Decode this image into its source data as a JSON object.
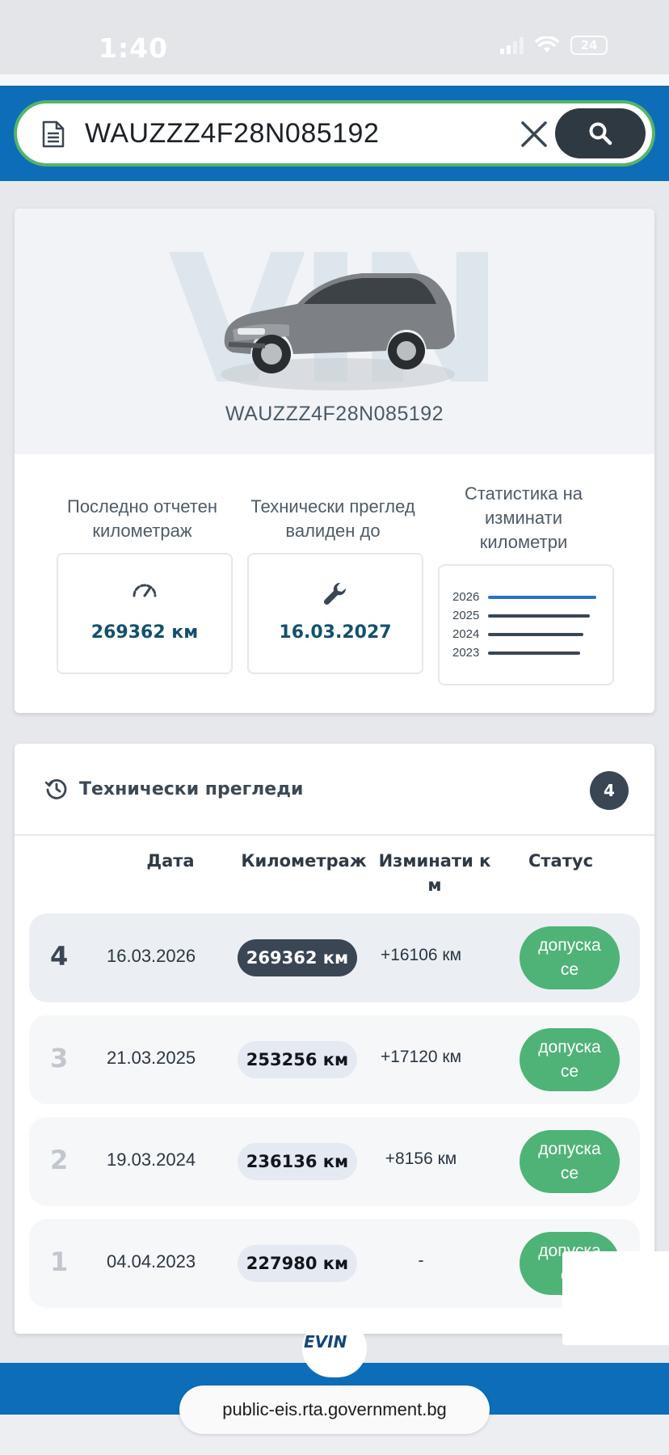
{
  "status_bar": {
    "time": "1:40",
    "battery": "24"
  },
  "search": {
    "value": "WAUZZZ4F28N085192"
  },
  "vehicle": {
    "watermark": "VIN",
    "vin": "WAUZZZ4F28N085192",
    "mileage": {
      "title_line1": "Последно отчетен",
      "title_line2": "километраж",
      "value": "269362 км"
    },
    "inspection": {
      "title_line1": "Технически преглед",
      "title_line2": "валиден до",
      "value": "16.03.2027"
    },
    "stats": {
      "title_line1": "Статистика на",
      "title_line2": "изминати",
      "title_line3": "километри",
      "years": [
        "2026",
        "2025",
        "2024",
        "2023"
      ],
      "accent": "#2a6fc9",
      "neutral": "#3a4654"
    }
  },
  "inspections": {
    "title": "Технически прегледи",
    "count": "4",
    "headers": {
      "date": "Дата",
      "mileage": "Километраж",
      "traveled_line1": "Изминати к",
      "traveled_line2": "м",
      "status": "Статус"
    },
    "rows": [
      {
        "index": "4",
        "date": "16.03.2026",
        "mileage": "269362 км",
        "diff": "+16106 км",
        "status_line1": "допуска",
        "status_line2": "се"
      },
      {
        "index": "3",
        "date": "21.03.2025",
        "mileage": "253256 км",
        "diff": "+17120 км",
        "status_line1": "допуска",
        "status_line2": "се"
      },
      {
        "index": "2",
        "date": "19.03.2024",
        "mileage": "236136 км",
        "diff": "+8156 км",
        "status_line1": "допуска",
        "status_line2": "се"
      },
      {
        "index": "1",
        "date": "04.04.2023",
        "mileage": "227980 км",
        "diff": "-",
        "status_line1": "допуска",
        "status_line2": "се"
      }
    ],
    "status_color": "#4fb378"
  },
  "footer": {
    "logo": "EVIN",
    "url": "public-eis.rta.government.bg"
  }
}
